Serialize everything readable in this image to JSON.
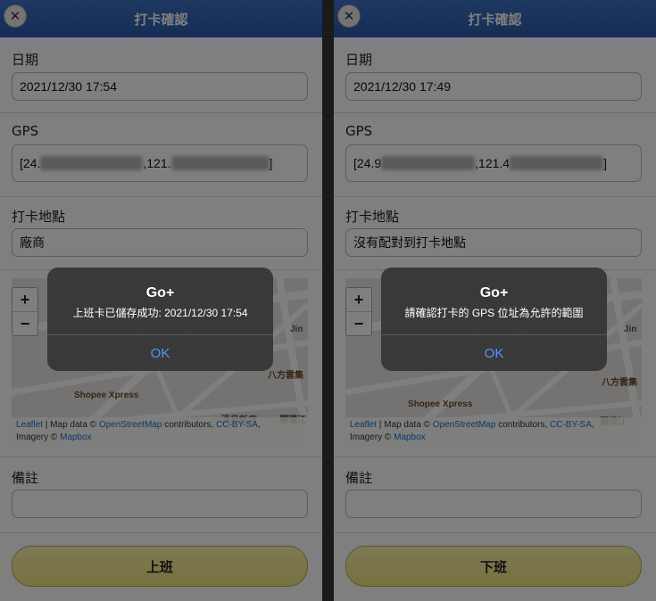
{
  "left": {
    "header": {
      "title": "打卡確認"
    },
    "date": {
      "label": "日期",
      "value": "2021/12/30 17:54"
    },
    "gps": {
      "label": "GPS",
      "part1": "[24.",
      "part2": ",121.",
      "part3": "]"
    },
    "location": {
      "label": "打卡地點",
      "value": "廠商"
    },
    "map": {
      "zoom_in": "+",
      "zoom_out": "−",
      "place1": "Shopee Xpress",
      "place2": "八方雲集",
      "place3": "溫泉飯店",
      "place4": "麗瓏江",
      "road": "Jin",
      "attrib": {
        "leaflet": "Leaflet",
        "sep": " | Map data © ",
        "osm": "OpenStreetMap",
        "contributors": " contributors, ",
        "license": "CC-BY-SA",
        "comma": ",",
        "imagery": "Imagery © ",
        "mapbox": "Mapbox"
      }
    },
    "note": {
      "label": "備註",
      "value": ""
    },
    "submit_label": "上班",
    "alert": {
      "title": "Go+",
      "message": "上班卡已儲存成功: 2021/12/30 17:54",
      "ok": "OK"
    }
  },
  "right": {
    "header": {
      "title": "打卡確認"
    },
    "date": {
      "label": "日期",
      "value": "2021/12/30 17:49"
    },
    "gps": {
      "label": "GPS",
      "part1": "[24.9",
      "part2": ",121.4",
      "part3": "]"
    },
    "location": {
      "label": "打卡地點",
      "value": "沒有配對到打卡地點"
    },
    "map": {
      "zoom_in": "+",
      "zoom_out": "−",
      "place1": "Shopee Xpress",
      "place2": "八方雲集",
      "place3": "麗瓏江",
      "road": "Jin",
      "attrib": {
        "leaflet": "Leaflet",
        "sep": " | Map data © ",
        "osm": "OpenStreetMap",
        "contributors": " contributors, ",
        "license": "CC-BY-SA",
        "comma": ",",
        "imagery": "Imagery © ",
        "mapbox": "Mapbox"
      }
    },
    "note": {
      "label": "備註",
      "value": ""
    },
    "submit_label": "下班",
    "alert": {
      "title": "Go+",
      "message": "請確認打卡的 GPS 位址為允許的範圍",
      "ok": "OK"
    }
  },
  "colors": {
    "header": "#2a5aa6",
    "button": "#eee37c",
    "alert_ok": "#4f98f5"
  },
  "icons": {
    "close": "close-icon"
  }
}
